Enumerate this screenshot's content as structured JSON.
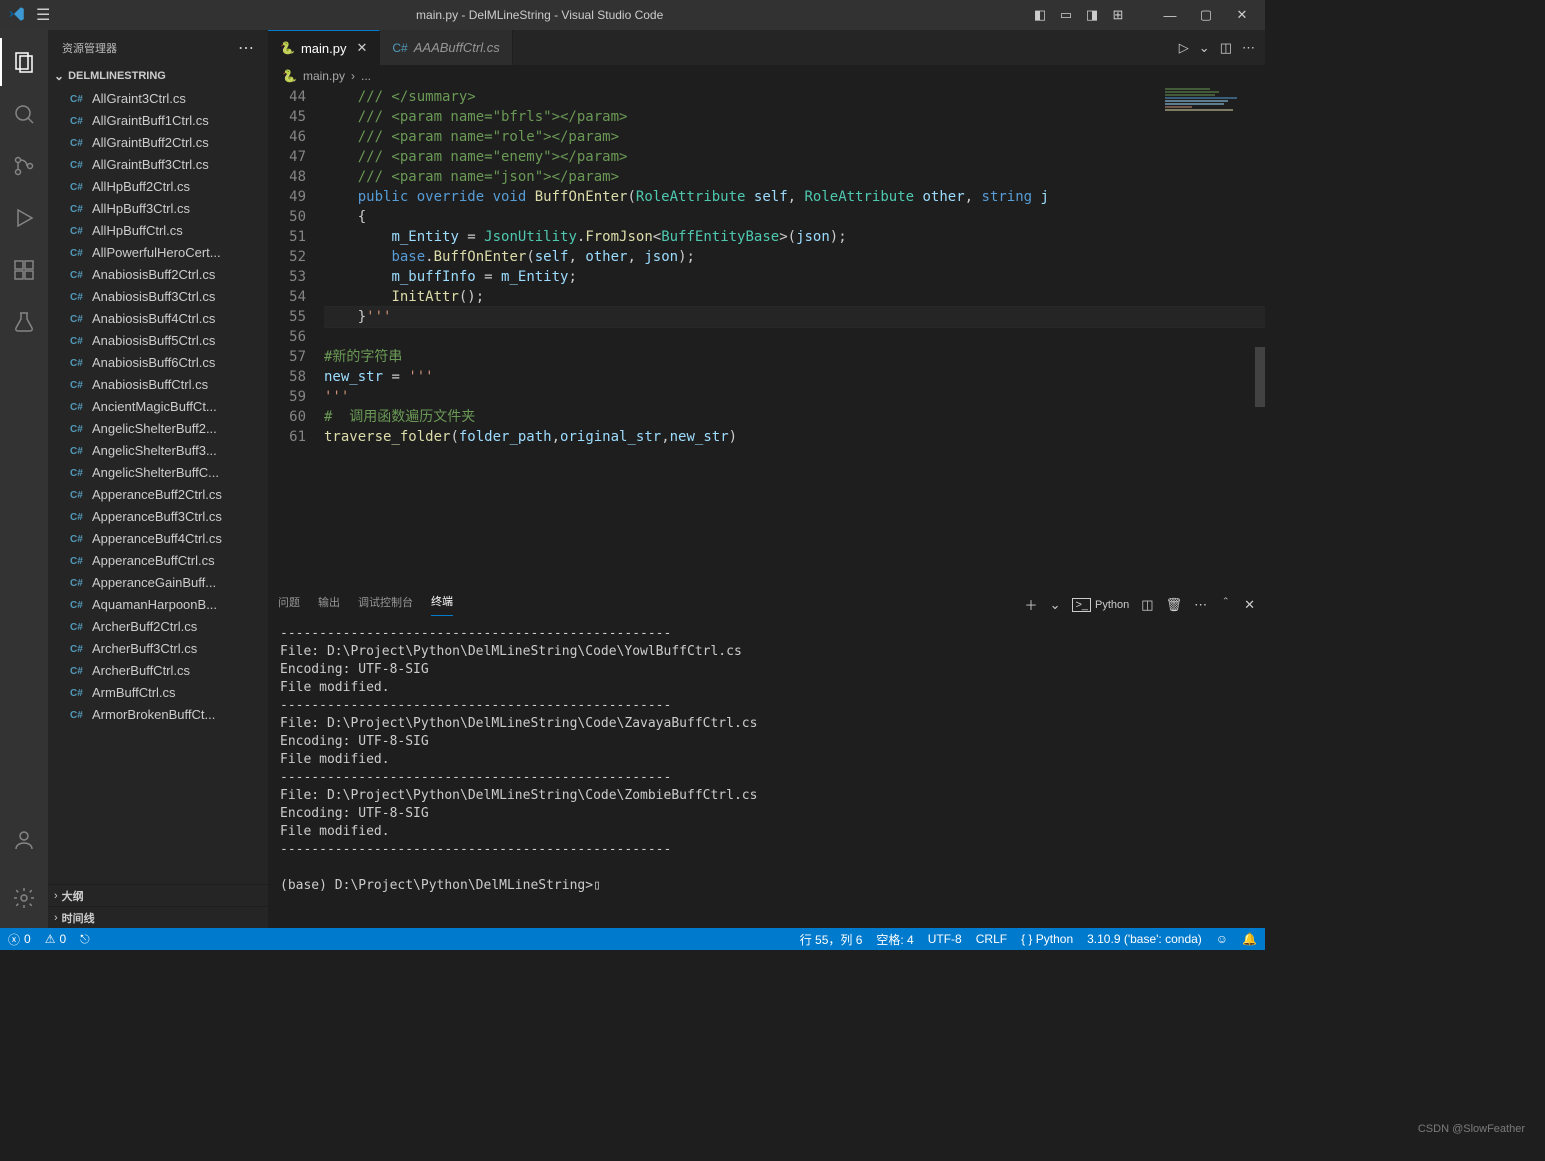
{
  "title": "main.py - DelMLineString - Visual Studio Code",
  "sidebar": {
    "headerLabel": "资源管理器",
    "folder": "DELMLINESTRING",
    "files": [
      "AllGraint3Ctrl.cs",
      "AllGraintBuff1Ctrl.cs",
      "AllGraintBuff2Ctrl.cs",
      "AllGraintBuff3Ctrl.cs",
      "AllHpBuff2Ctrl.cs",
      "AllHpBuff3Ctrl.cs",
      "AllHpBuffCtrl.cs",
      "AllPowerfulHeroCert...",
      "AnabiosisBuff2Ctrl.cs",
      "AnabiosisBuff3Ctrl.cs",
      "AnabiosisBuff4Ctrl.cs",
      "AnabiosisBuff5Ctrl.cs",
      "AnabiosisBuff6Ctrl.cs",
      "AnabiosisBuffCtrl.cs",
      "AncientMagicBuffCt...",
      "AngelicShelterBuff2...",
      "AngelicShelterBuff3...",
      "AngelicShelterBuffC...",
      "ApperanceBuff2Ctrl.cs",
      "ApperanceBuff3Ctrl.cs",
      "ApperanceBuff4Ctrl.cs",
      "ApperanceBuffCtrl.cs",
      "ApperanceGainBuff...",
      "AquamanHarpoonB...",
      "ArcherBuff2Ctrl.cs",
      "ArcherBuff3Ctrl.cs",
      "ArcherBuffCtrl.cs",
      "ArmBuffCtrl.cs",
      "ArmorBrokenBuffCt..."
    ],
    "outline": "大纲",
    "timeline": "时间线"
  },
  "tabs": {
    "main": "main.py",
    "secondary": "AAABuffCtrl.cs"
  },
  "breadcrumb": {
    "file": "main.py",
    "more": "..."
  },
  "code": {
    "startLine": 44,
    "lines": [
      {
        "n": 44,
        "html": "    <span class='c-com'>/// &lt;/summary&gt;</span>"
      },
      {
        "n": 45,
        "html": "    <span class='c-com'>/// &lt;param name=\"bfrls\"&gt;&lt;/param&gt;</span>"
      },
      {
        "n": 46,
        "html": "    <span class='c-com'>/// &lt;param name=\"role\"&gt;&lt;/param&gt;</span>"
      },
      {
        "n": 47,
        "html": "    <span class='c-com'>/// &lt;param name=\"enemy\"&gt;&lt;/param&gt;</span>"
      },
      {
        "n": 48,
        "html": "    <span class='c-com'>/// &lt;param name=\"json\"&gt;&lt;/param&gt;</span>"
      },
      {
        "n": 49,
        "html": "    <span class='c-key'>public override void</span> <span class='c-fn'>BuffOnEnter</span>(<span class='c-type'>RoleAttribute</span> <span class='c-var'>self</span>, <span class='c-type'>RoleAttribute</span> <span class='c-var'>other</span>, <span class='c-key'>string</span> <span class='c-var'>j</span>"
      },
      {
        "n": 50,
        "html": "    {"
      },
      {
        "n": 51,
        "html": "        <span class='c-var'>m_Entity</span> = <span class='c-type'>JsonUtility</span>.<span class='c-fn'>FromJson</span>&lt;<span class='c-type'>BuffEntityBase</span>&gt;(<span class='c-var'>json</span>);"
      },
      {
        "n": 52,
        "html": "        <span class='c-key'>base</span>.<span class='c-fn'>BuffOnEnter</span>(<span class='c-var'>self</span>, <span class='c-var'>other</span>, <span class='c-var'>json</span>);"
      },
      {
        "n": 53,
        "html": "        <span class='c-var'>m_buffInfo</span> = <span class='c-var'>m_Entity</span>;"
      },
      {
        "n": 54,
        "html": "        <span class='c-fn'>InitAttr</span>();"
      },
      {
        "n": 55,
        "html": "    }<span class='c-str'>'''</span>",
        "hl": true
      },
      {
        "n": 56,
        "html": ""
      },
      {
        "n": 57,
        "html": "<span class='c-com'>#新的字符串</span>"
      },
      {
        "n": 58,
        "html": "<span class='c-var'>new_str</span> = <span class='c-str'>'''</span>"
      },
      {
        "n": 59,
        "html": "<span class='c-str'>'''</span>"
      },
      {
        "n": 60,
        "html": "<span class='c-com'>#  调用函数遍历文件夹</span>"
      },
      {
        "n": 61,
        "html": "<span class='c-fn'>traverse_folder</span>(<span class='c-var'>folder_path</span>,<span class='c-var'>original_str</span>,<span class='c-var'>new_str</span>)"
      }
    ]
  },
  "panel": {
    "tabs": {
      "problems": "问题",
      "output": "输出",
      "debug": "调试控制台",
      "terminal": "终端"
    },
    "selector": "Python",
    "terminal": "--------------------------------------------------\nFile: D:\\Project\\Python\\DelMLineString\\Code\\YowlBuffCtrl.cs\nEncoding: UTF-8-SIG\nFile modified.\n--------------------------------------------------\nFile: D:\\Project\\Python\\DelMLineString\\Code\\ZavayaBuffCtrl.cs\nEncoding: UTF-8-SIG\nFile modified.\n--------------------------------------------------\nFile: D:\\Project\\Python\\DelMLineString\\Code\\ZombieBuffCtrl.cs\nEncoding: UTF-8-SIG\nFile modified.\n--------------------------------------------------\n\n(base) D:\\Project\\Python\\DelMLineString>▯"
  },
  "status": {
    "errors": "0",
    "warnings": "0",
    "port": "",
    "cursor": "行 55，列 6",
    "spaces": "空格: 4",
    "encoding": "UTF-8",
    "eol": "CRLF",
    "lang": "{ } Python",
    "interp": "3.10.9 ('base': conda)"
  },
  "watermark": "CSDN @SlowFeather"
}
